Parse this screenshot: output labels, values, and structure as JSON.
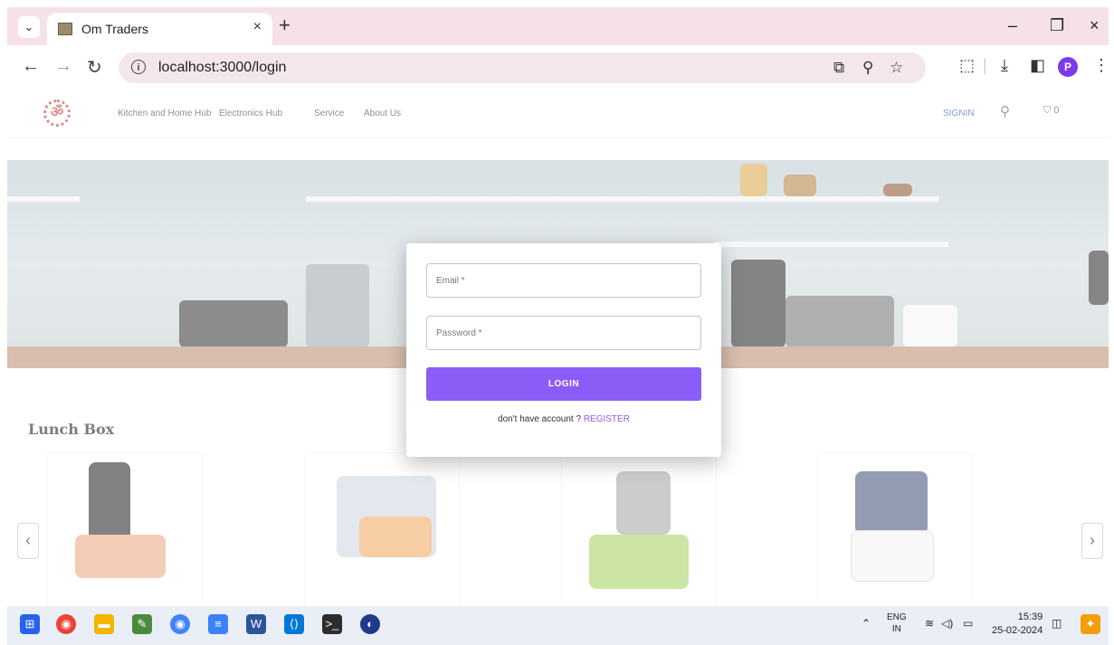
{
  "browser": {
    "tab_title": "Om Traders",
    "tab_close": "×",
    "new_tab": "+",
    "url": "localhost:3000/login",
    "window_controls": {
      "minimize": "–",
      "restore": "❐",
      "close": "×"
    },
    "profile_initial": "P",
    "icons": [
      "back-icon",
      "forward-icon",
      "reload-icon",
      "info-icon",
      "cast-icon",
      "zoom-icon",
      "star-icon",
      "extensions-icon",
      "downloads-icon",
      "sidepanel-icon",
      "menu-icon"
    ]
  },
  "site": {
    "logo_symbol": "ॐ",
    "nav": [
      "Kitchen and Home Hub",
      "Electronics Hub",
      "Service",
      "About Us"
    ],
    "signin": "SIGNIN",
    "cart_count": "0"
  },
  "section": {
    "title": "Lunch Box"
  },
  "login_form": {
    "email_placeholder": "Email *",
    "password_placeholder": "Password *",
    "login_label": "LOGIN",
    "register_prompt": "don't have account ?",
    "register_link": "REGISTER"
  },
  "taskbar": {
    "lang_primary": "ENG",
    "lang_secondary": "IN",
    "time": "15:39",
    "date": "25-02-2024"
  },
  "colors": {
    "accent": "#8b5cf6",
    "tabstrip": "#f6e1e7",
    "taskbar": "#e9eef7"
  }
}
